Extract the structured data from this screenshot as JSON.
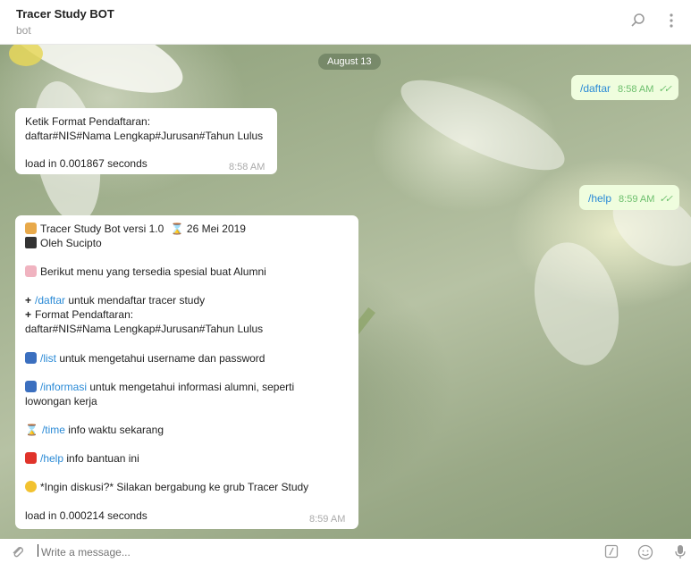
{
  "header": {
    "title": "Tracer Study BOT",
    "subtitle": "bot",
    "search_icon": "search-icon",
    "menu_icon": "more-vertical-icon"
  },
  "chat": {
    "date": "August 13",
    "msg1": {
      "text": "/daftar",
      "time": "8:58 AM",
      "ticks": "✓✓"
    },
    "msg2": {
      "line1": "Ketik Format Pendaftaran:",
      "line2": "daftar#NIS#Nama Lengkap#Jurusan#Tahun Lulus",
      "line3": "load in 0.001867 seconds",
      "time": "8:58 AM"
    },
    "msg3": {
      "text": "/help",
      "time": "8:59 AM",
      "ticks": "✓✓"
    },
    "msg4": {
      "l1": "Tracer Study Bot versi 1.0",
      "l1b": "26 Mei 2019",
      "l2": "Oleh Sucipto",
      "l3": "Berikut menu yang tersedia spesial buat Alumni",
      "l4_cmd": "/daftar",
      "l4": " untuk mendaftar tracer study",
      "l5": "Format Pendaftaran:",
      "l6": "daftar#NIS#Nama Lengkap#Jurusan#Tahun Lulus",
      "l7_cmd": "/list",
      "l7": " untuk mengetahui username dan password",
      "l8_cmd": "/informasi",
      "l8": " untuk mengetahui informasi alumni, seperti",
      "l9": "lowongan kerja",
      "l10_cmd": "/time",
      "l10": " info waktu sekarang",
      "l11_cmd": "/help",
      "l11": " info bantuan ini",
      "l12": "*Ingin diskusi?* Silakan bergabung ke grub Tracer Study",
      "l13": "load in 0.000214 seconds",
      "time": "8:59 AM"
    }
  },
  "composer": {
    "placeholder": "Write a message...",
    "attach_icon": "paperclip-icon",
    "commands_icon": "slash-commands-icon",
    "emoji_icon": "smiley-icon",
    "mic_icon": "microphone-icon"
  },
  "colors": {
    "link": "#2a8ad6",
    "outgoing_bubble": "#effdde",
    "incoming_bubble": "#ffffff"
  }
}
